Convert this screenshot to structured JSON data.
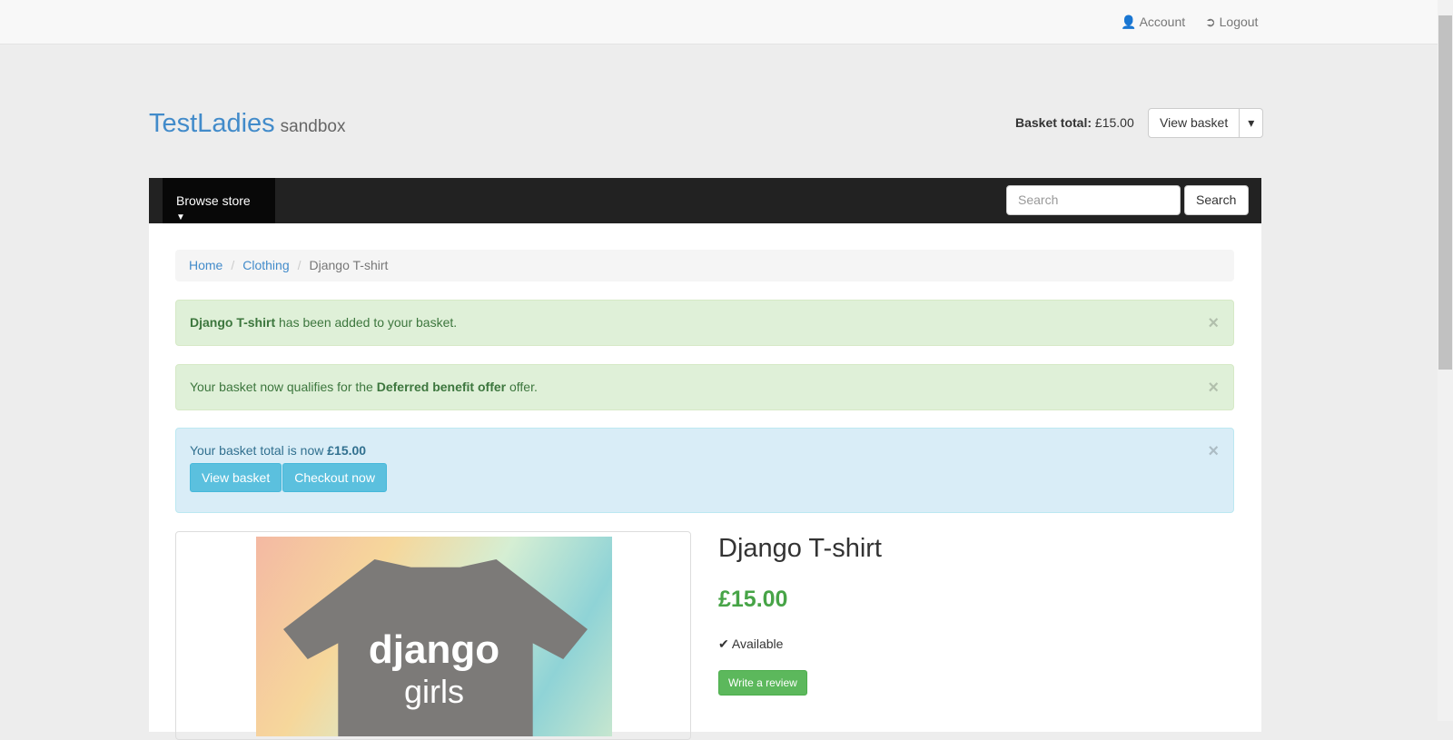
{
  "topbar": {
    "account": "Account",
    "logout": "Logout"
  },
  "brand": {
    "name": "TestLadies",
    "sub": "sandbox"
  },
  "basket": {
    "label": "Basket total:",
    "total": "£15.00",
    "view": "View basket"
  },
  "nav": {
    "browse": "Browse store",
    "search_placeholder": "Search",
    "search_button": "Search"
  },
  "breadcrumb": {
    "home": "Home",
    "clothing": "Clothing",
    "current": "Django T-shirt"
  },
  "alerts": {
    "a1_bold": "Django T-shirt",
    "a1_rest": " has been added to your basket.",
    "a2_pre": "Your basket now qualifies for the ",
    "a2_bold": "Deferred benefit offer",
    "a2_post": " offer.",
    "a3_pre": "Your basket total is now ",
    "a3_bold": "£15.00",
    "view_basket": "View basket",
    "checkout": "Checkout now",
    "close": "×"
  },
  "product": {
    "title": "Django T-shirt",
    "price": "£15.00",
    "availability": "Available",
    "review": "Write a review",
    "image_text1": "django",
    "image_text2": "girls"
  }
}
